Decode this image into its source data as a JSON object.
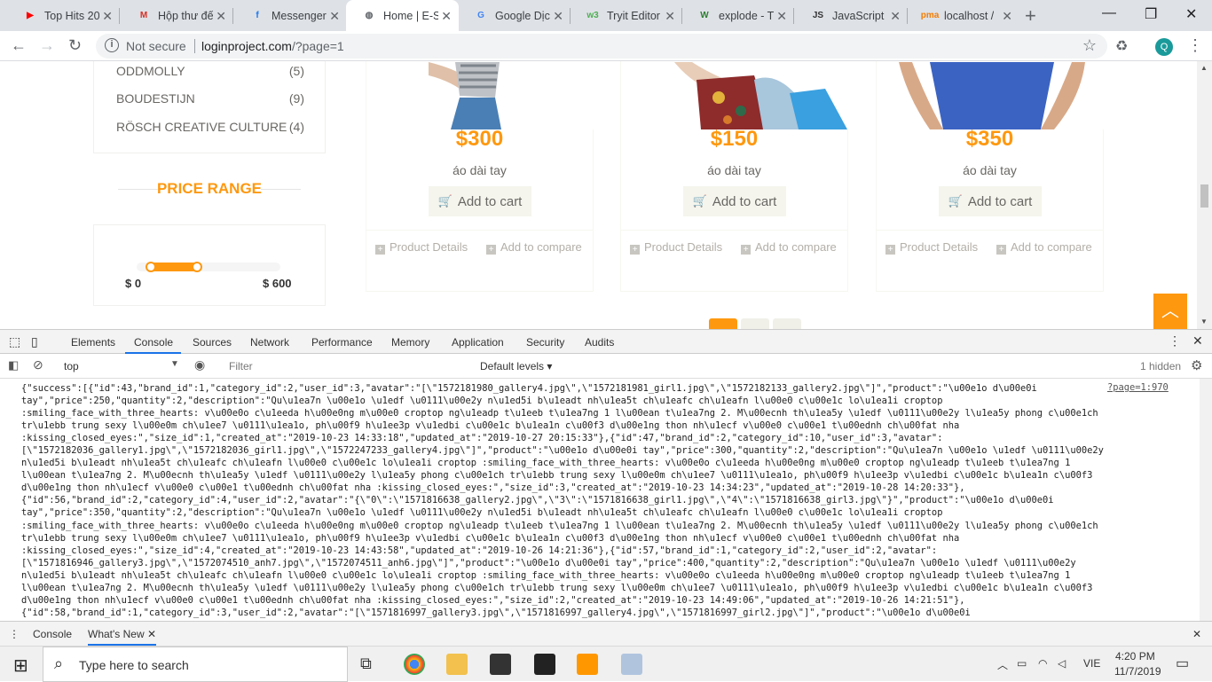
{
  "browser": {
    "tabs": [
      {
        "title": "Top Hits 20",
        "icon": "youtube-icon",
        "color": "#ff0000",
        "glyph": "▶"
      },
      {
        "title": "Hộp thư đế",
        "icon": "gmail-icon",
        "color": "#d93025",
        "glyph": "M"
      },
      {
        "title": "Messenger",
        "icon": "facebook-icon",
        "color": "#1877f2",
        "glyph": "f"
      },
      {
        "title": "Home | E-Sh",
        "icon": "globe-icon",
        "color": "#5f6368",
        "glyph": "◍"
      },
      {
        "title": "Google Dịch",
        "icon": "google-translate-icon",
        "color": "#4285f4",
        "glyph": "G"
      },
      {
        "title": "Tryit Editor",
        "icon": "w3schools-icon",
        "color": "#4caf50",
        "glyph": "w3"
      },
      {
        "title": "explode - Tạ",
        "icon": "wiki-icon",
        "color": "#2e7d32",
        "glyph": "W"
      },
      {
        "title": "JavaScript f",
        "icon": "js-icon",
        "color": "#333333",
        "glyph": "JS"
      },
      {
        "title": "localhost / ",
        "icon": "phpmyadmin-icon",
        "color": "#f57c00",
        "glyph": "pma"
      }
    ],
    "url_not_secure": "Not secure",
    "url_host": "loginproject.com",
    "url_query": "/?page=1",
    "profile_initial": "Q"
  },
  "page": {
    "brands": [
      {
        "name": "ODDMOLLY",
        "count": "(5)"
      },
      {
        "name": "BOUDESTIJN",
        "count": "(9)"
      },
      {
        "name": "RÖSCH CREATIVE CULTURE",
        "count": "(4)"
      }
    ],
    "price_range_title": "PRICE RANGE",
    "price_min": "$ 0",
    "price_max": "$ 600",
    "price_range_selected": [
      0.1,
      0.42
    ],
    "products": [
      {
        "price": "$300",
        "name": "áo dài tay",
        "cart": "Add to cart",
        "details": "Product Details",
        "compare": "Add to compare"
      },
      {
        "price": "$150",
        "name": "áo dài tay",
        "cart": "Add to cart",
        "details": "Product Details",
        "compare": "Add to compare"
      },
      {
        "price": "$350",
        "name": "áo dài tay",
        "cart": "Add to cart",
        "details": "Product Details",
        "compare": "Add to compare"
      }
    ],
    "accent": "#fe980f"
  },
  "devtools": {
    "tabs": [
      "Elements",
      "Console",
      "Sources",
      "Network",
      "Performance",
      "Memory",
      "Application",
      "Security",
      "Audits"
    ],
    "active_tab": "Console",
    "context": "top",
    "filter_placeholder": "Filter",
    "levels": "Default levels",
    "hidden": "1 hidden",
    "source_link": "?page=1:970",
    "console_lines": [
      "{\"success\":[{\"id\":43,\"brand_id\":1,\"category_id\":2,\"user_id\":3,\"avatar\":\"[\\\"1572181980_gallery4.jpg\\\",\\\"1572181981_girl1.jpg\\\",\\\"1572182133_gallery2.jpg\\\"]\",\"product\":\"\\u00e1o d\\u00e0i",
      "tay\",\"price\":250,\"quantity\":2,\"description\":\"Qu\\u1ea7n \\u00e1o \\u1edf \\u0111\\u00e2y n\\u1ed5i b\\u1eadt nh\\u1ea5t ch\\u1eafc ch\\u1eafn l\\u00e0 c\\u00e1c lo\\u1ea1i croptop",
      ":smiling_face_with_three_hearts: v\\u00e0o c\\u1eeda h\\u00e0ng m\\u00e0 croptop ng\\u1eadp t\\u1eeb t\\u1ea7ng 1 l\\u00ean t\\u1ea7ng 2. M\\u00ecnh th\\u1ea5y \\u1edf \\u0111\\u00e2y l\\u1ea5y phong c\\u00e1ch",
      "tr\\u1ebb trung sexy l\\u00e0m ch\\u1ee7 \\u0111\\u1ea1o, ph\\u00f9 h\\u1ee3p v\\u1edbi c\\u00e1c b\\u1ea1n c\\u00f3 d\\u00e1ng thon nh\\u1ecf v\\u00e0 c\\u00e1 t\\u00ednh ch\\u00fat nha",
      ":kissing_closed_eyes:\",\"size_id\":1,\"created_at\":\"2019-10-23 14:33:18\",\"updated_at\":\"2019-10-27 20:15:33\"},{\"id\":47,\"brand_id\":2,\"category_id\":10,\"user_id\":3,\"avatar\":",
      "[\\\"1572182036_gallery1.jpg\\\",\\\"1572182036_girl1.jpg\\\",\\\"1572247233_gallery4.jpg\\\"]\",\"product\":\"\\u00e1o d\\u00e0i tay\",\"price\":300,\"quantity\":2,\"description\":\"Qu\\u1ea7n \\u00e1o \\u1edf \\u0111\\u00e2y",
      "n\\u1ed5i b\\u1eadt nh\\u1ea5t ch\\u1eafc ch\\u1eafn l\\u00e0 c\\u00e1c lo\\u1ea1i croptop :smiling_face_with_three_hearts: v\\u00e0o c\\u1eeda h\\u00e0ng m\\u00e0 croptop ng\\u1eadp t\\u1eeb t\\u1ea7ng 1",
      "l\\u00ean t\\u1ea7ng 2. M\\u00ecnh th\\u1ea5y \\u1edf \\u0111\\u00e2y l\\u1ea5y phong c\\u00e1ch tr\\u1ebb trung sexy l\\u00e0m ch\\u1ee7 \\u0111\\u1ea1o, ph\\u00f9 h\\u1ee3p v\\u1edbi c\\u00e1c b\\u1ea1n c\\u00f3",
      "d\\u00e1ng thon nh\\u1ecf v\\u00e0 c\\u00e1 t\\u00ednh ch\\u00fat nha :kissing_closed_eyes:\",\"size_id\":3,\"created_at\":\"2019-10-23 14:34:23\",\"updated_at\":\"2019-10-28 14:20:33\"},",
      "{\"id\":56,\"brand_id\":2,\"category_id\":4,\"user_id\":2,\"avatar\":\"{\\\"0\\\":\\\"1571816638_gallery2.jpg\\\",\\\"3\\\":\\\"1571816638_girl1.jpg\\\",\\\"4\\\":\\\"1571816638_girl3.jpg\\\"}\",\"product\":\"\\u00e1o d\\u00e0i",
      "tay\",\"price\":350,\"quantity\":2,\"description\":\"Qu\\u1ea7n \\u00e1o \\u1edf \\u0111\\u00e2y n\\u1ed5i b\\u1eadt nh\\u1ea5t ch\\u1eafc ch\\u1eafn l\\u00e0 c\\u00e1c lo\\u1ea1i croptop",
      ":smiling_face_with_three_hearts: v\\u00e0o c\\u1eeda h\\u00e0ng m\\u00e0 croptop ng\\u1eadp t\\u1eeb t\\u1ea7ng 1 l\\u00ean t\\u1ea7ng 2. M\\u00ecnh th\\u1ea5y \\u1edf \\u0111\\u00e2y l\\u1ea5y phong c\\u00e1ch",
      "tr\\u1ebb trung sexy l\\u00e0m ch\\u1ee7 \\u0111\\u1ea1o, ph\\u00f9 h\\u1ee3p v\\u1edbi c\\u00e1c b\\u1ea1n c\\u00f3 d\\u00e1ng thon nh\\u1ecf v\\u00e0 c\\u00e1 t\\u00ednh ch\\u00fat nha",
      ":kissing_closed_eyes:\",\"size_id\":4,\"created_at\":\"2019-10-23 14:43:58\",\"updated_at\":\"2019-10-26 14:21:36\"},{\"id\":57,\"brand_id\":1,\"category_id\":2,\"user_id\":2,\"avatar\":",
      "[\\\"1571816946_gallery3.jpg\\\",\\\"1572074510_anh7.jpg\\\",\\\"1572074511_anh6.jpg\\\"]\",\"product\":\"\\u00e1o d\\u00e0i tay\",\"price\":400,\"quantity\":2,\"description\":\"Qu\\u1ea7n \\u00e1o \\u1edf \\u0111\\u00e2y",
      "n\\u1ed5i b\\u1eadt nh\\u1ea5t ch\\u1eafc ch\\u1eafn l\\u00e0 c\\u00e1c lo\\u1ea1i croptop :smiling_face_with_three_hearts: v\\u00e0o c\\u1eeda h\\u00e0ng m\\u00e0 croptop ng\\u1eadp t\\u1eeb t\\u1ea7ng 1",
      "l\\u00ean t\\u1ea7ng 2. M\\u00ecnh th\\u1ea5y \\u1edf \\u0111\\u00e2y l\\u1ea5y phong c\\u00e1ch tr\\u1ebb trung sexy l\\u00e0m ch\\u1ee7 \\u0111\\u1ea1o, ph\\u00f9 h\\u1ee3p v\\u1edbi c\\u00e1c b\\u1ea1n c\\u00f3",
      "d\\u00e1ng thon nh\\u1ecf v\\u00e0 c\\u00e1 t\\u00ednh ch\\u00fat nha :kissing_closed_eyes:\",\"size_id\":2,\"created_at\":\"2019-10-23 14:49:06\",\"updated_at\":\"2019-10-26 14:21:51\"},",
      "{\"id\":58,\"brand_id\":1,\"category_id\":3,\"user_id\":2,\"avatar\":\"[\\\"1571816997_gallery3.jpg\\\",\\\"1571816997_gallery4.jpg\\\",\\\"1571816997_girl2.jpg\\\"]\",\"product\":\"\\u00e1o d\\u00e0i"
    ],
    "drawer_tabs": [
      "Console",
      "What's New"
    ]
  },
  "taskbar": {
    "search_placeholder": "Type here to search",
    "lang": "VIE",
    "time": "4:20 PM",
    "date": "11/7/2019"
  }
}
